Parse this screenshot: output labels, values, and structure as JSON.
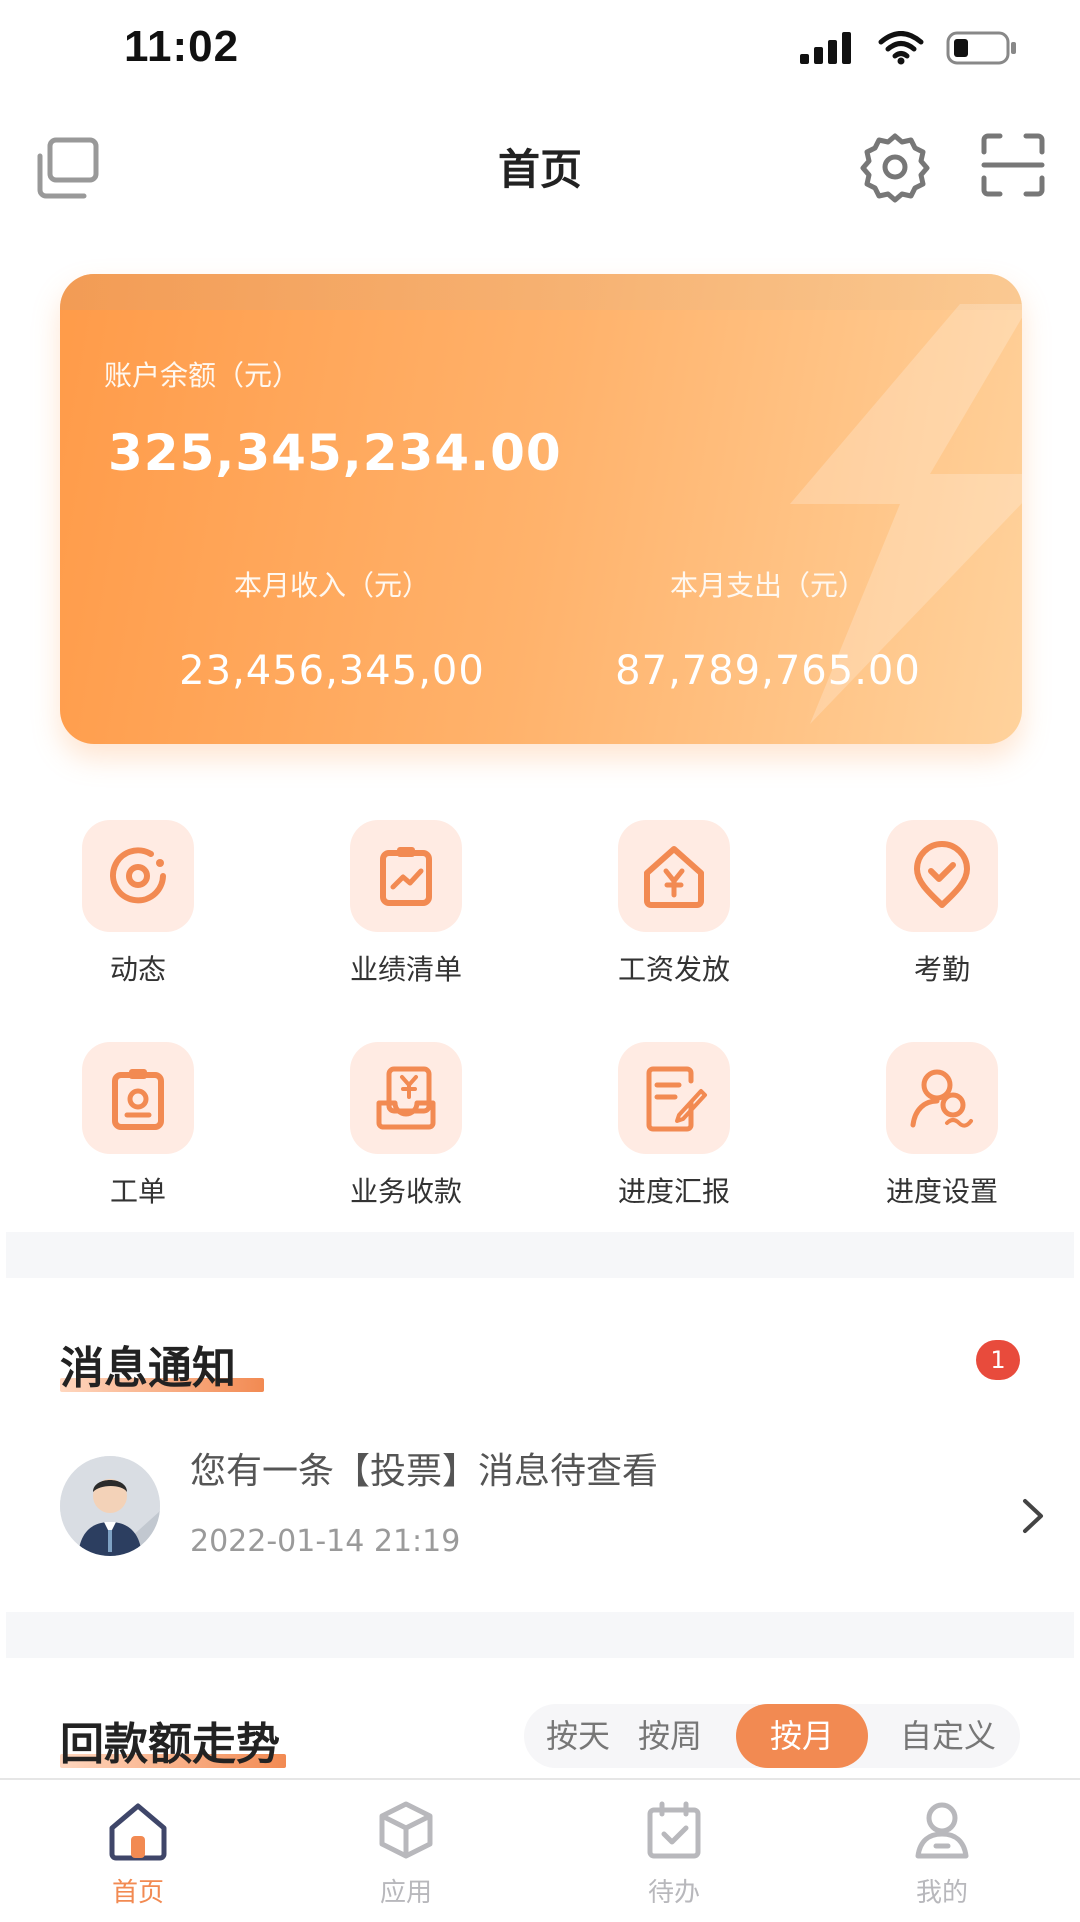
{
  "status_bar": {
    "time": "11:02"
  },
  "header": {
    "title": "首页"
  },
  "balance_card": {
    "balance_label": "账户余额（元）",
    "balance_value": "325,345,234.00",
    "income_label": "本月收入（元）",
    "income_value": "23,456,345,00",
    "expense_label": "本月支出（元）",
    "expense_value": "87,789,765.00"
  },
  "grid": {
    "items": [
      {
        "label": "动态",
        "icon": "dynamic-icon"
      },
      {
        "label": "业绩清单",
        "icon": "performance-list-icon"
      },
      {
        "label": "工资发放",
        "icon": "salary-icon"
      },
      {
        "label": "考勤",
        "icon": "attendance-icon"
      },
      {
        "label": "工单",
        "icon": "work-order-icon"
      },
      {
        "label": "业务收款",
        "icon": "business-payment-icon"
      },
      {
        "label": "进度汇报",
        "icon": "progress-report-icon"
      },
      {
        "label": "进度设置",
        "icon": "progress-settings-icon"
      }
    ]
  },
  "messages": {
    "title": "消息通知",
    "badge": "1",
    "item": {
      "text": "您有一条【投票】消息待查看",
      "time": "2022-01-14 21:19"
    }
  },
  "trend": {
    "title": "回款额走势",
    "options": [
      "按天",
      "按周",
      "按月",
      "自定义"
    ],
    "selected": "按月"
  },
  "tabbar": {
    "tabs": [
      {
        "label": "首页",
        "icon": "home-icon",
        "active": true
      },
      {
        "label": "应用",
        "icon": "cube-icon",
        "active": false
      },
      {
        "label": "待办",
        "icon": "calendar-check-icon",
        "active": false
      },
      {
        "label": "我的",
        "icon": "user-icon",
        "active": false
      }
    ]
  },
  "colors": {
    "accent": "#f28a52",
    "icon_bg": "#ffebe3",
    "badge": "#e84b3c"
  }
}
